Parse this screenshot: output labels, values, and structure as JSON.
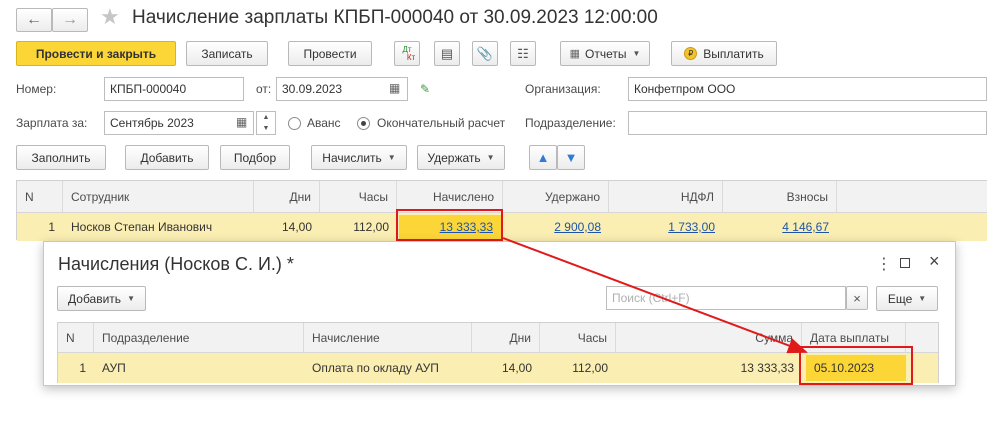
{
  "title": "Начисление зарплаты КПБП-000040 от 30.09.2023 12:00:00",
  "toolbar": {
    "post_close": "Провести и закрыть",
    "save": "Записать",
    "post": "Провести",
    "reports": "Отчеты",
    "pay": "Выплатить",
    "dtkt_top": "Дт",
    "dtkt_bottom": "Кт"
  },
  "header": {
    "number_label": "Номер:",
    "number_value": "КПБП-000040",
    "date_label": "от:",
    "date_value": "30.09.2023",
    "org_label": "Организация:",
    "org_value": "Конфетпром ООО",
    "salary_label": "Зарплата за:",
    "salary_value": "Сентябрь 2023",
    "advance_label": "Аванс",
    "final_label": "Окончательный расчет",
    "dept_label": "Подразделение:",
    "dept_value": ""
  },
  "actions": {
    "fill": "Заполнить",
    "add": "Добавить",
    "pick": "Подбор",
    "accrue": "Начислить",
    "withhold": "Удержать"
  },
  "table": {
    "columns": [
      "N",
      "Сотрудник",
      "Дни",
      "Часы",
      "Начислено",
      "Удержано",
      "НДФЛ",
      "Взносы"
    ],
    "rows": [
      {
        "n": "1",
        "employee": "Носков Степан Иванович",
        "days": "14,00",
        "hours": "112,00",
        "accrued": "13 333,33",
        "withheld": "2 900,08",
        "ndfl": "1 733,00",
        "contrib": "4 146,67"
      }
    ]
  },
  "dialog": {
    "title": "Начисления (Носков С. И.) *",
    "add": "Добавить",
    "search_placeholder": "Поиск (Ctrl+F)",
    "search_clear": "×",
    "more": "Еще",
    "columns": [
      "N",
      "Подразделение",
      "Начисление",
      "Дни",
      "Часы",
      "Сумма",
      "Дата выплаты"
    ],
    "rows": [
      {
        "n": "1",
        "dept": "АУП",
        "accrual": "Оплата по окладу АУП",
        "days": "14,00",
        "hours": "112,00",
        "sum": "13 333,33",
        "pay_date": "05.10.2023"
      }
    ]
  },
  "colors": {
    "accent": "#fcd637",
    "selected_row": "#fbeeb3",
    "highlight": "#e01a1a",
    "link": "#1f55a8"
  }
}
